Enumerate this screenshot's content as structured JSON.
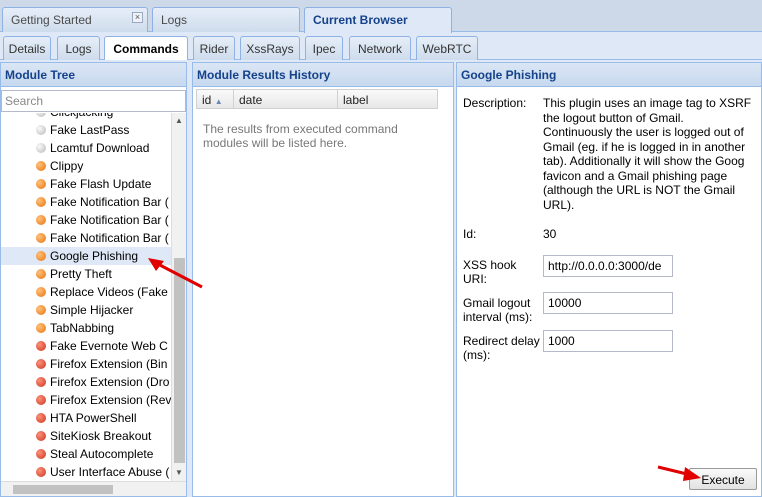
{
  "top_tabs": [
    {
      "label": "Getting Started",
      "closable": true
    },
    {
      "label": "Logs",
      "closable": false
    },
    {
      "label": "Current Browser",
      "active": true
    }
  ],
  "sub_tabs": [
    "Details",
    "Logs",
    "Commands",
    "Rider",
    "XssRays",
    "Ipec",
    "Network",
    "WebRTC"
  ],
  "active_sub_tab": "Commands",
  "module_tree": {
    "title": "Module Tree",
    "search_placeholder": "Search",
    "items": [
      {
        "label": "Clickjacking",
        "status": "grey"
      },
      {
        "label": "Fake LastPass",
        "status": "grey"
      },
      {
        "label": "Lcamtuf Download",
        "status": "grey"
      },
      {
        "label": "Clippy",
        "status": "orange"
      },
      {
        "label": "Fake Flash Update",
        "status": "orange"
      },
      {
        "label": "Fake Notification Bar (",
        "status": "orange"
      },
      {
        "label": "Fake Notification Bar (",
        "status": "orange"
      },
      {
        "label": "Fake Notification Bar (",
        "status": "orange"
      },
      {
        "label": "Google Phishing",
        "status": "orange",
        "selected": true
      },
      {
        "label": "Pretty Theft",
        "status": "orange"
      },
      {
        "label": "Replace Videos (Fake",
        "status": "orange"
      },
      {
        "label": "Simple Hijacker",
        "status": "orange"
      },
      {
        "label": "TabNabbing",
        "status": "orange"
      },
      {
        "label": "Fake Evernote Web C",
        "status": "red"
      },
      {
        "label": "Firefox Extension (Bin",
        "status": "red"
      },
      {
        "label": "Firefox Extension (Dro",
        "status": "red"
      },
      {
        "label": "Firefox Extension (Rev",
        "status": "red"
      },
      {
        "label": "HTA PowerShell",
        "status": "red"
      },
      {
        "label": "SiteKiosk Breakout",
        "status": "red"
      },
      {
        "label": "Steal Autocomplete",
        "status": "red"
      },
      {
        "label": "User Interface Abuse (",
        "status": "red"
      }
    ]
  },
  "results": {
    "title": "Module Results History",
    "columns": [
      "id",
      "date",
      "label"
    ],
    "sort_indicator": "▲",
    "empty_message": "The results from executed command modules will be listed here."
  },
  "details": {
    "title": "Google Phishing",
    "description_label": "Description:",
    "description_lines": [
      "This plugin uses an image tag to XSRF",
      "the logout button of Gmail.",
      "Continuously the user is logged out of",
      "Gmail (eg. if he is logged in in another",
      "tab). Additionally it will show the Goog",
      "favicon and a Gmail phishing page",
      "(although the URL is NOT the Gmail",
      "URL)."
    ],
    "id_label": "Id:",
    "id_value": "30",
    "xss_label_1": "XSS hook",
    "xss_label_2": "URI:",
    "xss_value": "http://0.0.0.0:3000/de",
    "logout_label_1": "Gmail logout",
    "logout_label_2": "interval (ms):",
    "logout_value": "10000",
    "redirect_label_1": "Redirect delay",
    "redirect_label_2": "(ms):",
    "redirect_value": "1000",
    "execute_label": "Execute"
  },
  "colors": {
    "accent": "#15428b",
    "panel_border": "#99bbe8",
    "annotation_arrow": "#e00000",
    "status_grey": "#c8c8c8",
    "status_orange": "#f07f1a",
    "status_red": "#d2411f"
  },
  "icons": [
    "close-icon",
    "sort-ascending-icon",
    "scroll-up-arrow-icon",
    "scroll-down-arrow-icon",
    "red-annotation-arrow-icon"
  ]
}
